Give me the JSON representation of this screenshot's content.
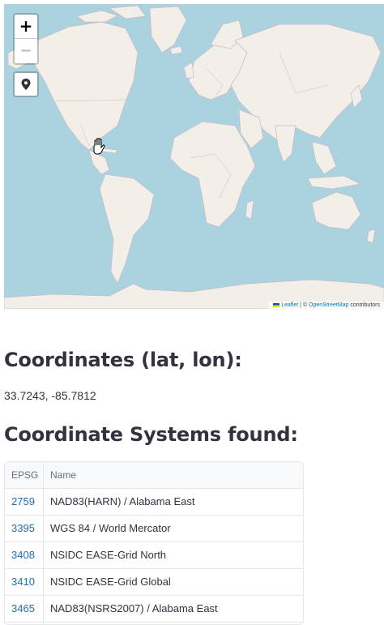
{
  "map": {
    "zoom_in_label": "+",
    "zoom_out_label": "−",
    "locate_icon": "map-pin-icon",
    "cursor_icon": "hand-grab-icon",
    "attribution": {
      "leaflet": "Leaflet",
      "separator": " | © ",
      "osm": "OpenStreetMap",
      "contributors": " contributors"
    },
    "colors": {
      "water": "#aad3df",
      "land": "#f2efe9",
      "border": "#b9a8b9"
    }
  },
  "coordinates": {
    "heading": "Coordinates (lat, lon):",
    "value": "33.7243, -85.7812"
  },
  "crs": {
    "heading": "Coordinate Systems found:",
    "columns": [
      "EPSG",
      "Name"
    ],
    "rows": [
      {
        "epsg": "2759",
        "name": "NAD83(HARN) / Alabama East"
      },
      {
        "epsg": "3395",
        "name": "WGS 84 / World Mercator"
      },
      {
        "epsg": "3408",
        "name": "NSIDC EASE-Grid North"
      },
      {
        "epsg": "3410",
        "name": "NSIDC EASE-Grid Global"
      },
      {
        "epsg": "3465",
        "name": "NAD83(NSRS2007) / Alabama East"
      }
    ]
  }
}
